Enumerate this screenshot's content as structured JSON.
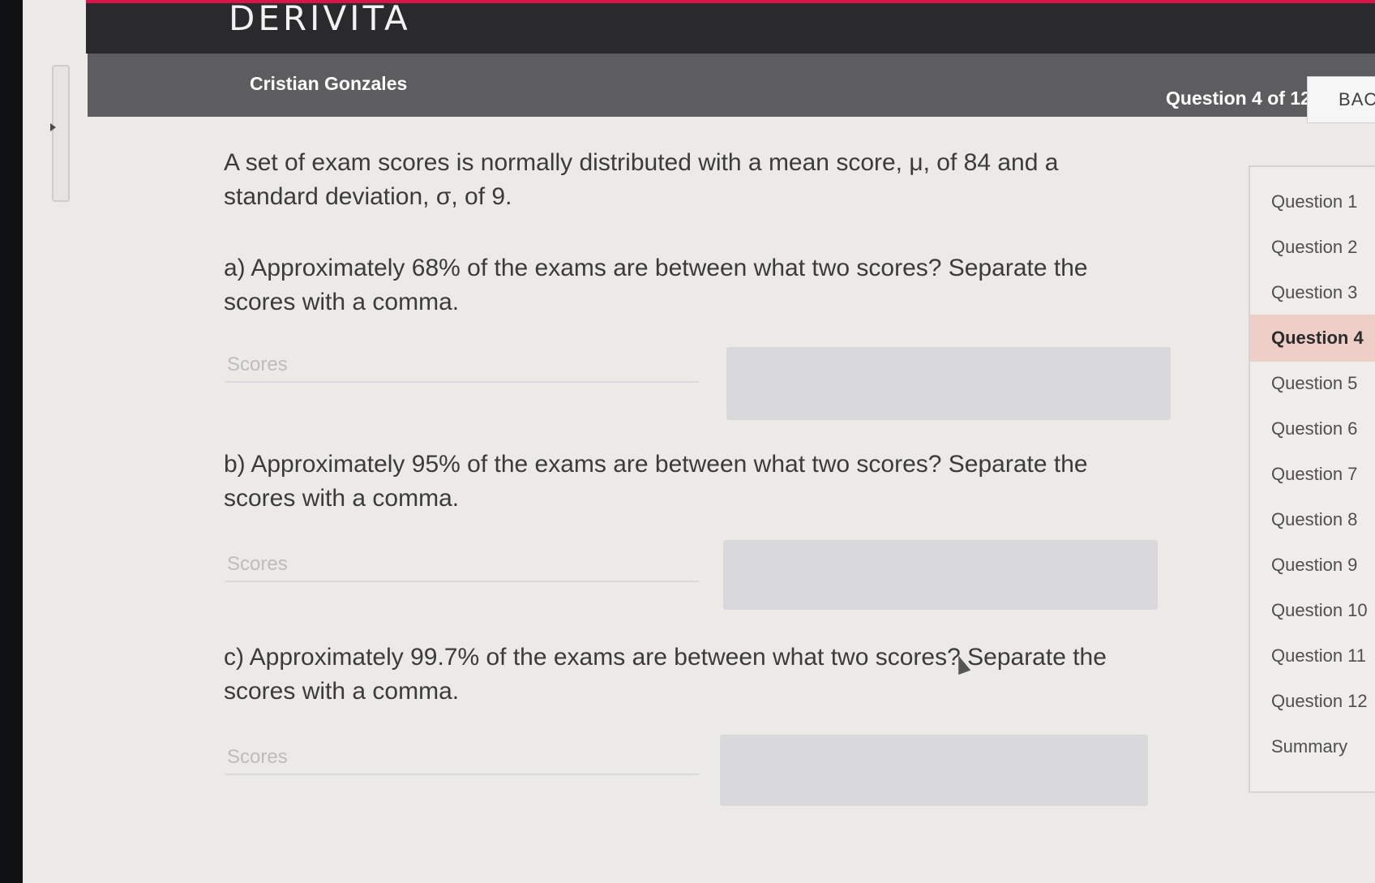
{
  "brand": {
    "logo": "DERIVITA"
  },
  "header": {
    "user_name": "Cristian Gonzales",
    "question_counter": "Question 4 of 12",
    "back_label": "BACK"
  },
  "question": {
    "prompt_line1": "A set of exam scores is normally distributed with a mean score, μ, of 84 and a",
    "prompt_line2": "standard deviation, σ, of 9.",
    "parts": [
      {
        "line1": "a) Approximately 68% of the exams are between what two scores? Separate the",
        "line2": "scores with a comma.",
        "placeholder": "Scores"
      },
      {
        "line1": "b) Approximately 95% of the exams are between what two scores? Separate the",
        "line2": "scores with a comma.",
        "placeholder": "Scores"
      },
      {
        "line1": "c) Approximately 99.7% of the exams are between what two scores? Separate the",
        "line2": "scores with a comma.",
        "placeholder": "Scores"
      }
    ]
  },
  "nav": {
    "items": [
      "Question 1",
      "Question 2",
      "Question 3",
      "Question 4",
      "Question 5",
      "Question 6",
      "Question 7",
      "Question 8",
      "Question 9",
      "Question 10",
      "Question 11",
      "Question 12",
      "Summary"
    ],
    "active_index": 3,
    "active_color": "#edcfc8"
  },
  "colors": {
    "accent": "#d6164a",
    "brand_bar": "#2a2a2c",
    "user_bar": "#5d5d60"
  }
}
